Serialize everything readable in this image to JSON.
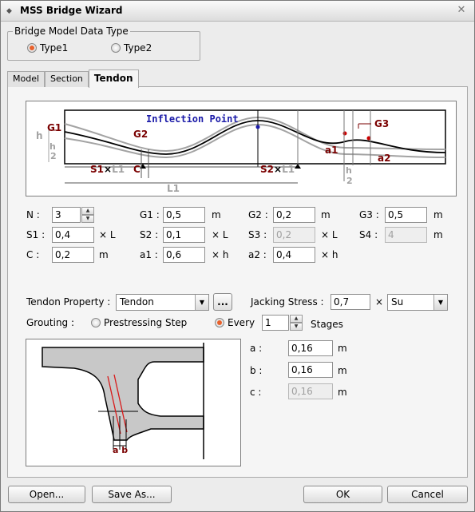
{
  "window": {
    "title": "MSS Bridge Wizard",
    "close_symbol": "✕"
  },
  "model_type": {
    "legend": "Bridge Model Data Type",
    "options": [
      {
        "label": "Type1",
        "selected": true
      },
      {
        "label": "Type2",
        "selected": false
      }
    ]
  },
  "tabs": [
    {
      "label": "Model"
    },
    {
      "label": "Section"
    },
    {
      "label": "Tendon",
      "active": true
    }
  ],
  "diagram": {
    "inflection_label": "Inflection Point",
    "labels": {
      "g1": "G1",
      "g2": "G2",
      "g3": "G3",
      "h": "h",
      "h_half_num": "h",
      "h_half_den": "2",
      "s1": "S1",
      "s1_times": "×",
      "s1_l1": "L1",
      "c": "C",
      "s2": "S2",
      "s2_times": "×",
      "s2_l1": "L1",
      "l1": "L1",
      "a1": "a1",
      "a2": "a2"
    },
    "colors": {
      "label_dark": "#7a0000",
      "inflection": "#1a1aa8",
      "grey": "#a3a3a3"
    }
  },
  "params": {
    "n_label": "N :",
    "n_value": "3",
    "g1_label": "G1 :",
    "g1_value": "0,5",
    "g1_unit": "m",
    "g2_label": "G2 :",
    "g2_value": "0,2",
    "g2_unit": "m",
    "g3_label": "G3 :",
    "g3_value": "0,5",
    "g3_unit": "m",
    "s1_label": "S1 :",
    "s1_value": "0,4",
    "s1_unit": "× L",
    "s2_label": "S2 :",
    "s2_value": "0,1",
    "s2_unit": "× L",
    "s3_label": "S3 :",
    "s3_value": "0,2",
    "s3_unit": "× L",
    "s4_label": "S4 :",
    "s4_value": "4",
    "s4_unit": "m",
    "c_label": "C :",
    "c_value": "0,2",
    "c_unit": "m",
    "a1_label": "a1 :",
    "a1_value": "0,6",
    "a1_unit": "× h",
    "a2_label": "a2 :",
    "a2_value": "0,4",
    "a2_unit": "× h"
  },
  "tendon": {
    "property_label": "Tendon Property :",
    "property_value": "Tendon",
    "browse_label": "...",
    "jacking_label": "Jacking Stress :",
    "jacking_value": "0,7",
    "jacking_times": "×",
    "jacking_unit": "Su"
  },
  "grouting": {
    "label": "Grouting :",
    "options": [
      {
        "label": "Prestressing Step",
        "selected": false
      },
      {
        "label": "Every",
        "selected": true
      }
    ],
    "every_value": "1",
    "stages_label": "Stages"
  },
  "section": {
    "ab_label": "a b",
    "a_label": "a :",
    "a_value": "0,16",
    "a_unit": "m",
    "b_label": "b :",
    "b_value": "0,16",
    "b_unit": "m",
    "c_label": "c :",
    "c_value": "0,16",
    "c_unit": "m"
  },
  "buttons": {
    "open": "Open...",
    "save_as": "Save As...",
    "ok": "OK",
    "cancel": "Cancel"
  }
}
